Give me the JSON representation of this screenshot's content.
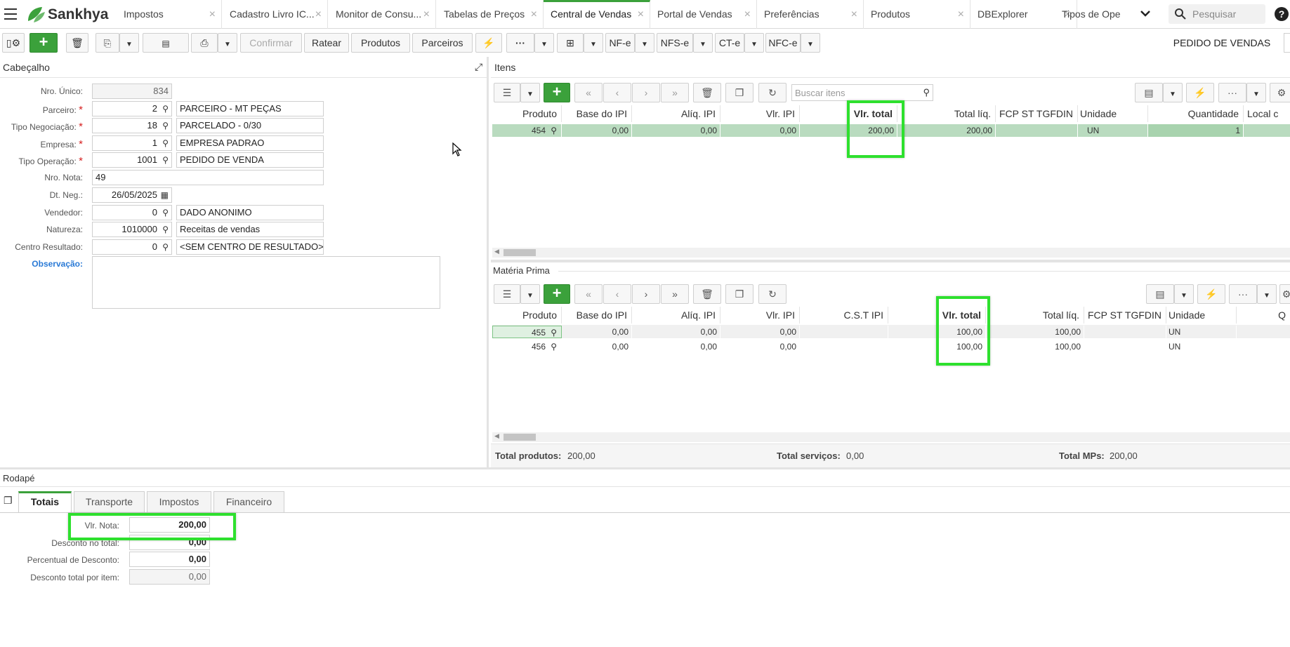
{
  "brand": {
    "name": "Sankhya"
  },
  "tabs": [
    {
      "label": "Impostos"
    },
    {
      "label": "Cadastro Livro IC..."
    },
    {
      "label": "Monitor de Consu..."
    },
    {
      "label": "Tabelas de Preços"
    },
    {
      "label": "Central de Vendas"
    },
    {
      "label": "Portal de Vendas"
    },
    {
      "label": "Preferências"
    },
    {
      "label": "Produtos"
    },
    {
      "label": "DBExplorer"
    },
    {
      "label": "Tipos de Ope"
    }
  ],
  "search": {
    "placeholder": "Pesquisar"
  },
  "toolbar": {
    "confirmar": "Confirmar",
    "ratear": "Ratear",
    "produtos": "Produtos",
    "parceiros": "Parceiros",
    "nfe": "NF-e",
    "nfse": "NFS-e",
    "cte": "CT-e",
    "nfce": "NFC-e",
    "page_title": "PEDIDO DE VENDAS"
  },
  "header": {
    "title": "Cabeçalho",
    "fields": {
      "nro_unico": {
        "label": "Nro. Único:",
        "value": "834"
      },
      "parceiro": {
        "label": "Parceiro:",
        "code": "2",
        "desc": "PARCEIRO - MT PEÇAS"
      },
      "tipo_negociacao": {
        "label": "Tipo Negociação:",
        "code": "18",
        "desc": "PARCELADO - 0/30"
      },
      "empresa": {
        "label": "Empresa:",
        "code": "1",
        "desc": "EMPRESA PADRAO"
      },
      "tipo_operacao": {
        "label": "Tipo Operação:",
        "code": "1001",
        "desc": "PEDIDO DE VENDA"
      },
      "nro_nota": {
        "label": "Nro. Nota:",
        "value": "49"
      },
      "dt_neg": {
        "label": "Dt. Neg.:",
        "value": "26/05/2025"
      },
      "vendedor": {
        "label": "Vendedor:",
        "code": "0",
        "desc": "DADO ANONIMO"
      },
      "natureza": {
        "label": "Natureza:",
        "code": "1010000",
        "desc": "Receitas de vendas"
      },
      "centro_resultado": {
        "label": "Centro Resultado:",
        "code": "0",
        "desc": "<SEM CENTRO DE RESULTADO>"
      },
      "observacao": {
        "label": "Observação:"
      }
    }
  },
  "itens": {
    "title": "Itens",
    "search_placeholder": "Buscar itens",
    "columns": [
      "Produto",
      "Base do IPI",
      "Alíq. IPI",
      "Vlr. IPI",
      "Vlr. total",
      "Total líq.",
      "FCP ST TGFDIN",
      "Unidade",
      "Quantidade",
      "Local c"
    ],
    "rows": [
      {
        "produto": "454",
        "base_ipi": "0,00",
        "aliq_ipi": "0,00",
        "vlr_ipi": "0,00",
        "vlr_total": "200,00",
        "total_liq": "200,00",
        "fcp": "",
        "unidade": "UN",
        "quantidade": "1"
      }
    ]
  },
  "materia_prima": {
    "title": "Matéria Prima",
    "columns": [
      "Produto",
      "Base do IPI",
      "Alíq. IPI",
      "Vlr. IPI",
      "C.S.T IPI",
      "Vlr. total",
      "Total líq.",
      "FCP ST TGFDIN",
      "Unidade",
      "Q"
    ],
    "rows": [
      {
        "produto": "455",
        "base_ipi": "0,00",
        "aliq_ipi": "0,00",
        "vlr_ipi": "0,00",
        "cst_ipi": "",
        "vlr_total": "100,00",
        "total_liq": "100,00",
        "fcp": "",
        "unidade": "UN"
      },
      {
        "produto": "456",
        "base_ipi": "0,00",
        "aliq_ipi": "0,00",
        "vlr_ipi": "0,00",
        "cst_ipi": "",
        "vlr_total": "100,00",
        "total_liq": "100,00",
        "fcp": "",
        "unidade": "UN"
      }
    ]
  },
  "totals_bar": {
    "total_produtos_label": "Total produtos:",
    "total_produtos": "200,00",
    "total_servicos_label": "Total serviços:",
    "total_servicos": "0,00",
    "total_mps_label": "Total MPs:",
    "total_mps": "200,00"
  },
  "rodape": {
    "title": "Rodapé",
    "tabs": [
      "Totais",
      "Transporte",
      "Impostos",
      "Financeiro"
    ],
    "fields": {
      "vlr_nota": {
        "label": "Vlr. Nota:",
        "value": "200,00"
      },
      "desconto_total": {
        "label": "Desconto no total:",
        "value": "0,00"
      },
      "percentual_desconto": {
        "label": "Percentual de Desconto:",
        "value": "0,00"
      },
      "desconto_item": {
        "label": "Desconto total por item:",
        "value": "0,00"
      }
    }
  },
  "colors": {
    "accent": "#3ba13b",
    "highlight": "#2ee02e",
    "selected_row": "#b9dbbf"
  }
}
